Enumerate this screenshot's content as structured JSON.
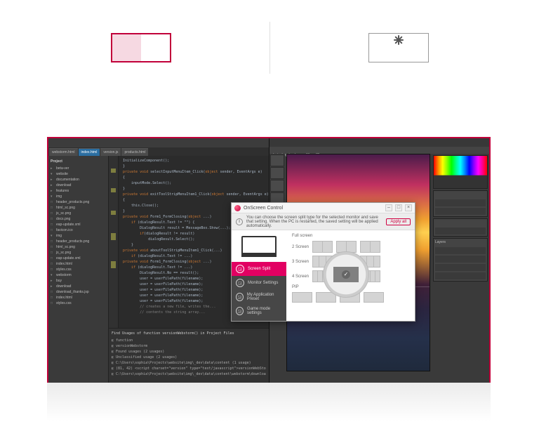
{
  "tabs": {
    "active": 0
  },
  "ide": {
    "tabs": [
      {
        "label": "webstorm.html",
        "active": false
      },
      {
        "label": "index.html",
        "active": true
      },
      {
        "label": "version.js",
        "active": false
      },
      {
        "label": "products.html",
        "active": false
      }
    ],
    "tree_header": "Project",
    "tree": [
      {
        "label": "beta-ver",
        "kind": "dir"
      },
      {
        "label": "website",
        "kind": "dir",
        "open": true
      },
      {
        "label": "documentation",
        "kind": "dir"
      },
      {
        "label": "download",
        "kind": "dir"
      },
      {
        "label": "features",
        "kind": "dir"
      },
      {
        "label": "img",
        "kind": "dir",
        "open": true
      },
      {
        "label": "header_products.png",
        "kind": "file"
      },
      {
        "label": "html_sc.png",
        "kind": "file"
      },
      {
        "label": "js_sc.png",
        "kind": "file"
      },
      {
        "label": "docs.png",
        "kind": "file"
      },
      {
        "label": "eap-update.xml",
        "kind": "file"
      },
      {
        "label": "favicon.ico",
        "kind": "file"
      },
      {
        "label": "img",
        "kind": "dir",
        "open": true
      },
      {
        "label": "header_products.png",
        "kind": "file"
      },
      {
        "label": "html_sc.png",
        "kind": "file"
      },
      {
        "label": "js_sc.png",
        "kind": "file"
      },
      {
        "label": "eap-update.xml",
        "kind": "file"
      },
      {
        "label": "index.html",
        "kind": "file"
      },
      {
        "label": "styles.css",
        "kind": "file"
      },
      {
        "label": "webstorm",
        "kind": "dir",
        "open": true
      },
      {
        "label": "buy",
        "kind": "dir"
      },
      {
        "label": "download",
        "kind": "dir"
      },
      {
        "label": "download_thanks.jsp",
        "kind": "file"
      },
      {
        "label": "index.html",
        "kind": "file"
      },
      {
        "label": "styles.css",
        "kind": "file"
      }
    ],
    "code_lines": [
      {
        "raw": "InitializeComponent();"
      },
      {
        "raw": "}"
      },
      {
        "raw": ""
      },
      {
        "raw": "private void selectInputMenuItem_Click(object sender, EventArgs e)",
        "kw": [
          "private",
          "void",
          "object"
        ]
      },
      {
        "raw": "{"
      },
      {
        "raw": "    inputMode.Select();"
      },
      {
        "raw": "}"
      },
      {
        "raw": ""
      },
      {
        "raw": "private void exitToolStripMenuItem1_Click(object sender, EventArgs e)",
        "kw": [
          "private",
          "void",
          "object"
        ]
      },
      {
        "raw": "{"
      },
      {
        "raw": "    this.Close();"
      },
      {
        "raw": "}"
      },
      {
        "raw": ""
      },
      {
        "raw": "private void Form1_FormClosing(object ...)",
        "kw": [
          "private",
          "void",
          "object"
        ]
      },
      {
        "raw": "    if (dialogResult.Text != \"\") {",
        "kw": [
          "if"
        ]
      },
      {
        "raw": "        DialogResult result = MessageBox.Show(...);"
      },
      {
        "raw": "        if(dialogResult != result)",
        "kw": [
          "if"
        ]
      },
      {
        "raw": "            dialogResult.Select();"
      },
      {
        "raw": "    }"
      },
      {
        "raw": ""
      },
      {
        "raw": "private void aboutToolStripMenuItem1_Click(...)",
        "kw": [
          "private",
          "void"
        ]
      },
      {
        "raw": "    if (dialogResult.Text != ...)",
        "kw": [
          "if"
        ]
      },
      {
        "raw": ""
      },
      {
        "raw": "private void Form1_FormClosing(object ...)",
        "kw": [
          "private",
          "void",
          "object"
        ]
      },
      {
        "raw": "    if (dialogResult.Text != ...)",
        "kw": [
          "if"
        ]
      },
      {
        "raw": "        DialogResult.No == result();"
      },
      {
        "raw": "        user = userFilePath(filename);"
      },
      {
        "raw": "        user = userFilePath(filename);"
      },
      {
        "raw": "        user = userFilePath(filename);"
      },
      {
        "raw": "        user = userFilePath(filename);"
      },
      {
        "raw": "        user = userFilePath(filename);"
      },
      {
        "raw": "        // creates a new file, writes the...",
        "cm": true
      },
      {
        "raw": "        // contents the string array...",
        "cm": true
      }
    ],
    "usages": {
      "header": "Find Usages of function versionWebstorm() in Project Files",
      "lines": [
        "function",
        "versionWebstorm",
        "Found usages (2 usages)",
        "Unclassified usage (2 usages)",
        "C:\\Users\\sophia\\Projects\\website\\img\\_dev\\data\\content (1 usage)",
        "(81, 42) <script charset=\"version\" type=\"text/javascript\">versionWebStorm()</...>",
        "C:\\Users\\sophia\\Projects\\website\\img\\_dev\\data\\content\\webstorm\\download"
      ]
    }
  },
  "pe": {
    "tab_label": "photoshop-landscape-01.ps (2)",
    "panel_label": "Layers"
  },
  "dialog": {
    "title": "OnScreen Control",
    "info": "You can choose the screen split type for the selected monitor and save that setting. When the PC is restarted, the saved setting will be applied automatically.",
    "apply": "Apply all",
    "menu": [
      {
        "label": "Screen Split",
        "icon": "grid-icon",
        "active": true
      },
      {
        "label": "Monitor Settings",
        "icon": "gear-icon",
        "active": false
      },
      {
        "label": "My Application Preset",
        "icon": "window-icon",
        "active": false
      },
      {
        "label": "Game mode settings",
        "icon": "game-icon",
        "active": false
      }
    ],
    "sections": {
      "full": "Full screen",
      "two": "2 Screen",
      "three": "3 Screen",
      "four": "4 Screen",
      "pip": "PIP"
    }
  }
}
